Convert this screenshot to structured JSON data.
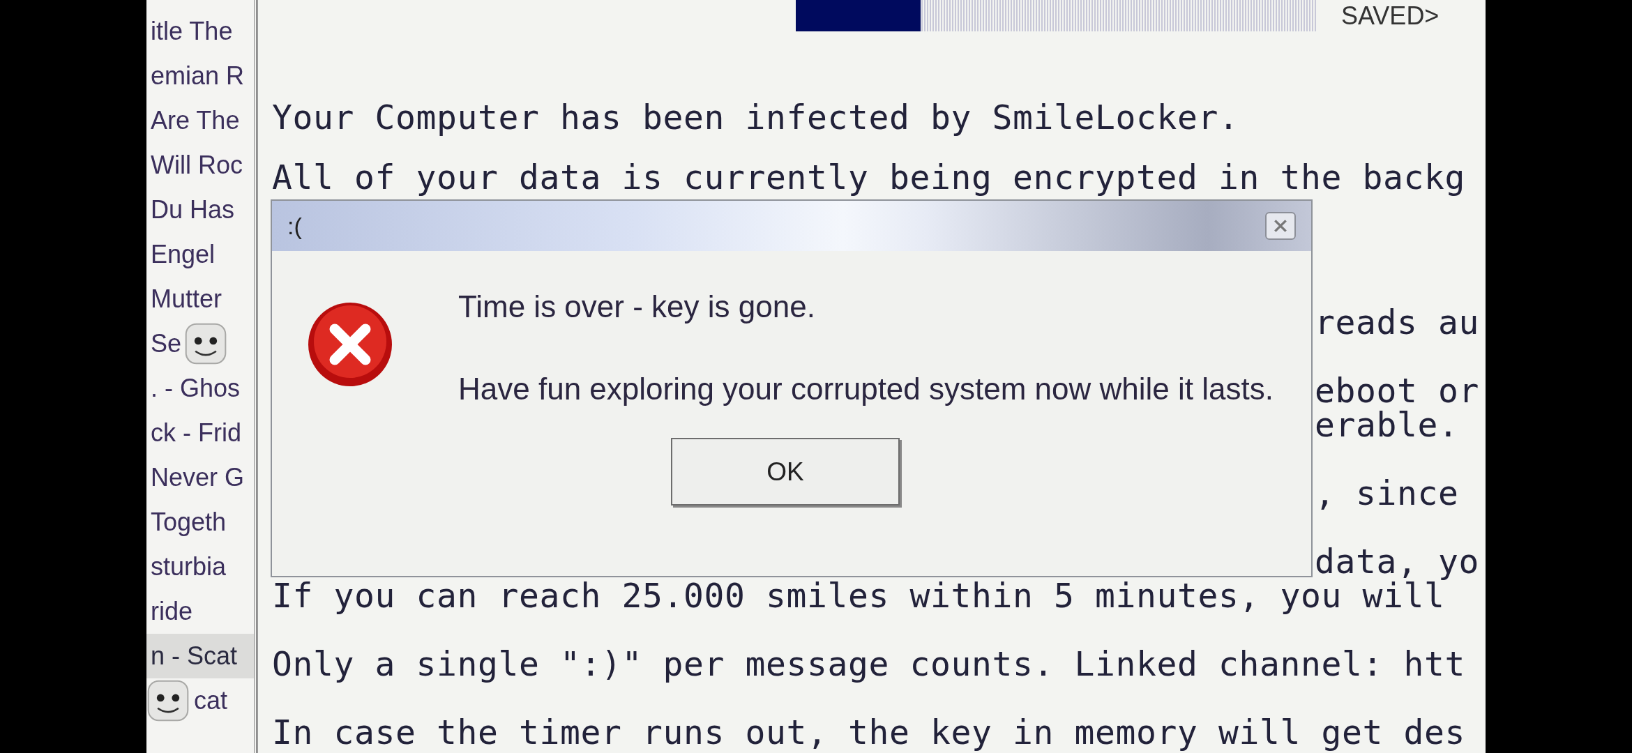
{
  "playlist": {
    "items": [
      {
        "label": "itle The",
        "selected": false
      },
      {
        "label": "emian R",
        "selected": false
      },
      {
        "label": "Are The",
        "selected": false
      },
      {
        "label": "Will Roc",
        "selected": false
      },
      {
        "label": "Du Has",
        "selected": false
      },
      {
        "label": "Engel",
        "selected": false
      },
      {
        "label": "Mutter",
        "selected": false
      },
      {
        "label": "Se",
        "selected": false,
        "smiley_after": true
      },
      {
        "label": ". - Ghos",
        "selected": false
      },
      {
        "label": "ck - Frid",
        "selected": false
      },
      {
        "label": "Never G",
        "selected": false
      },
      {
        "label": "Togeth",
        "selected": false
      },
      {
        "label": "sturbia",
        "selected": false
      },
      {
        "label": "ride",
        "selected": false
      },
      {
        "label": "n - Scat",
        "selected": true
      },
      {
        "label": "cat",
        "selected": false,
        "smiley_before": true
      }
    ]
  },
  "progress": {
    "level": 0.24,
    "label": "SAVED>"
  },
  "main_text": {
    "lines": [
      {
        "kind": "line",
        "text": "Your Computer has been infected by SmileLocker."
      },
      {
        "kind": "line",
        "text": "All of your data is currently being encrypted in the backg"
      },
      {
        "kind": "fragment",
        "text": "reads au"
      },
      {
        "kind": "fragment",
        "text": "eboot or"
      },
      {
        "kind": "fragment",
        "text": "erable."
      },
      {
        "kind": "fragment",
        "text": ", since"
      },
      {
        "kind": "fragment",
        "text": "data, yo"
      },
      {
        "kind": "line",
        "text": "If you can reach 25.000 smiles within 5 minutes, you will"
      },
      {
        "kind": "line",
        "text": "Only a single \":)\" per message counts. Linked channel: htt"
      },
      {
        "kind": "line",
        "text": "In case the timer runs out, the key in memory will get des"
      }
    ]
  },
  "dialog": {
    "title": ":(",
    "messages": [
      "Time is over - key is gone.",
      "Have fun exploring your corrupted system now while it lasts."
    ],
    "button": "OK"
  }
}
